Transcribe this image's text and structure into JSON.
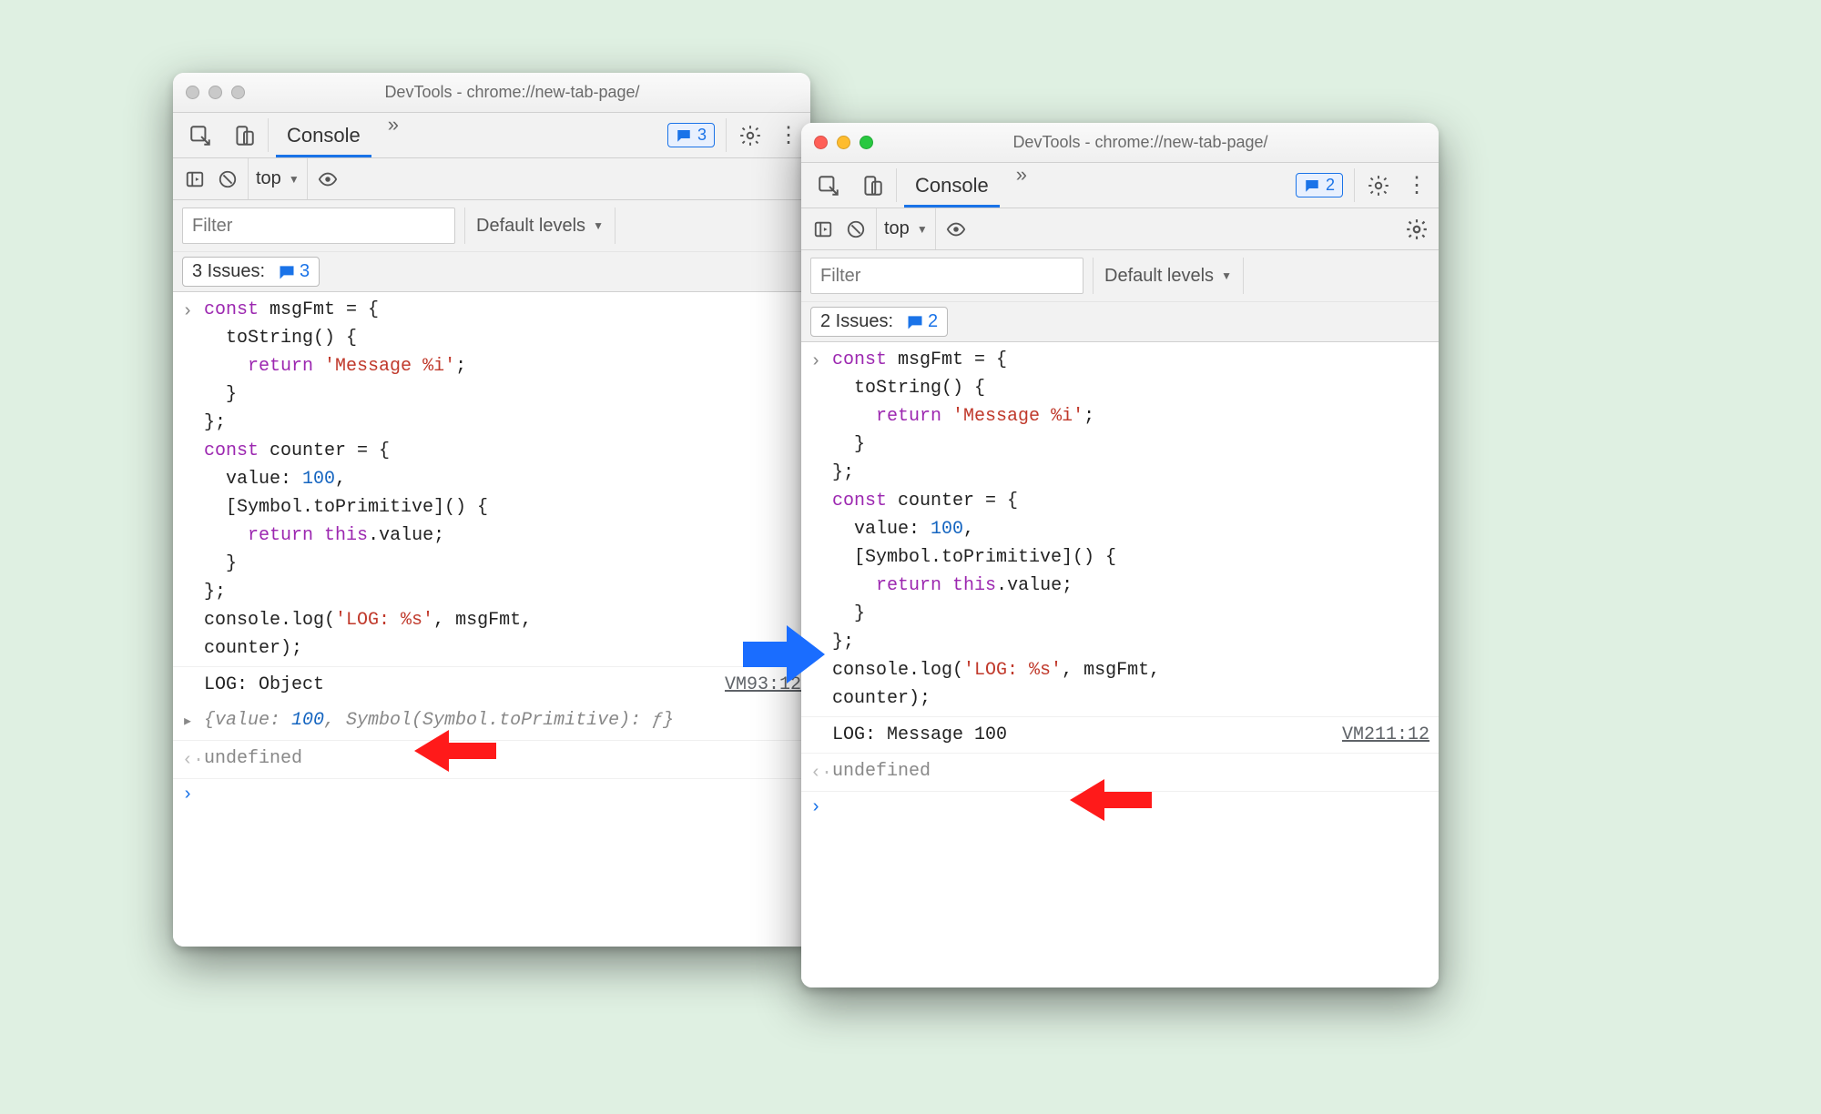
{
  "left": {
    "title": "DevTools - chrome://new-tab-page/",
    "traffic_active": false,
    "tab_console": "Console",
    "issue_chip_count": "3",
    "context_label": "top",
    "filter_placeholder": "Filter",
    "default_levels": "Default levels",
    "issues_line_text": "3 Issues:",
    "issues_line_count": "3",
    "code": {
      "l1": "const msgFmt = {",
      "l2": "  toString() {",
      "l3": "    return 'Message %i';",
      "l4": "  }",
      "l5": "};",
      "l6": "const counter = {",
      "l7": "  value: 100,",
      "l8": "  [Symbol.toPrimitive]() {",
      "l9": "    return this.value;",
      "l10": "  }",
      "l11": "};",
      "l12": "console.log('LOG: %s', msgFmt,",
      "l13": "counter);"
    },
    "output_line": "LOG: Object",
    "output_source": "VM93:12",
    "obj_preview": "{value: 100, Symbol(Symbol.toPrimitive): ƒ}",
    "undefined_label": "undefined"
  },
  "right": {
    "title": "DevTools - chrome://new-tab-page/",
    "traffic_active": true,
    "tab_console": "Console",
    "issue_chip_count": "2",
    "context_label": "top",
    "filter_placeholder": "Filter",
    "default_levels": "Default levels",
    "issues_line_text": "2 Issues:",
    "issues_line_count": "2",
    "code": {
      "l1": "const msgFmt = {",
      "l2": "  toString() {",
      "l3": "    return 'Message %i';",
      "l4": "  }",
      "l5": "};",
      "l6": "const counter = {",
      "l7": "  value: 100,",
      "l8": "  [Symbol.toPrimitive]() {",
      "l9": "    return this.value;",
      "l10": "  }",
      "l11": "};",
      "l12": "console.log('LOG: %s', msgFmt,",
      "l13": "counter);"
    },
    "output_line": "LOG: Message 100",
    "output_source": "VM211:12",
    "undefined_label": "undefined"
  }
}
